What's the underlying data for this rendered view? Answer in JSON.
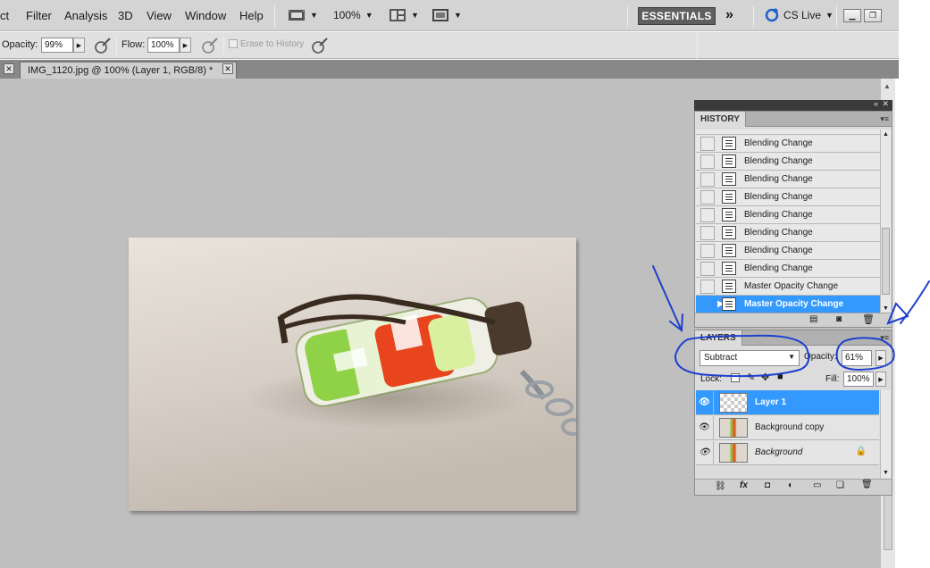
{
  "menu": {
    "items": [
      "ct",
      "Filter",
      "Analysis",
      "3D",
      "View",
      "Window",
      "Help"
    ],
    "zoom": "100%",
    "workspace": "ESSENTIALS",
    "cs_live": "CS Live"
  },
  "options": {
    "opacity_label": "Opacity:",
    "opacity_value": "99%",
    "flow_label": "Flow:",
    "flow_value": "100%",
    "erase_to_history": "Erase to History"
  },
  "document_tab": {
    "title": "IMG_1120.jpg @ 100% (Layer 1, RGB/8) *"
  },
  "history_panel": {
    "tab": "HISTORY",
    "states": [
      {
        "label": "Blending Change"
      },
      {
        "label": "Blending Change"
      },
      {
        "label": "Blending Change"
      },
      {
        "label": "Blending Change"
      },
      {
        "label": "Blending Change"
      },
      {
        "label": "Blending Change"
      },
      {
        "label": "Blending Change"
      },
      {
        "label": "Blending Change"
      },
      {
        "label": "Master Opacity Change"
      },
      {
        "label": "Master Opacity Change"
      }
    ]
  },
  "layers_panel": {
    "tab": "LAYERS",
    "blend_mode": "Subtract",
    "opacity_label": "Opacity:",
    "opacity_value": "61%",
    "lock_label": "Lock:",
    "fill_label": "Fill:",
    "fill_value": "100%",
    "layers": [
      {
        "name": "Layer 1"
      },
      {
        "name": "Background copy"
      },
      {
        "name": "Background"
      }
    ]
  },
  "colors": {
    "selection": "#3399ff",
    "annotation": "#1f3fcf"
  }
}
